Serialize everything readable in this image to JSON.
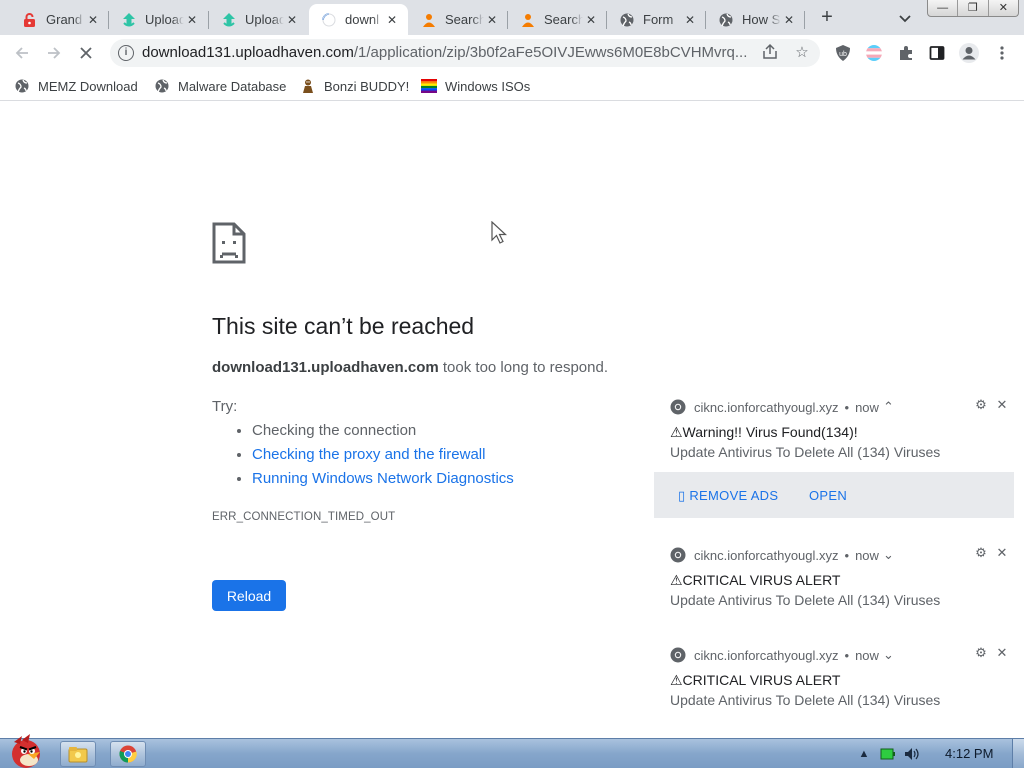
{
  "tabs": [
    {
      "title": "Grand",
      "icon": "red-lock-icon"
    },
    {
      "title": "Uploadhaven",
      "icon": "uploadhaven-icon"
    },
    {
      "title": "Uploadhaven",
      "icon": "uploadhaven-icon"
    },
    {
      "title": "downl",
      "icon": "loading-spinner-icon",
      "active": true
    },
    {
      "title": "Search",
      "icon": "search-person-icon"
    },
    {
      "title": "Search",
      "icon": "search-person-icon"
    },
    {
      "title": "Form",
      "icon": "globe-icon"
    },
    {
      "title": "How S",
      "icon": "globe-icon"
    }
  ],
  "window_controls": {
    "minimize": "—",
    "restore": "❐",
    "close": "✕"
  },
  "toolbar": {
    "url_host": "download131.uploadhaven.com",
    "url_path": "/1/application/zip/3b0f2aFe5OIVJEwws6M0E8bCVHMvrq..."
  },
  "bookmarks": [
    {
      "label": "MEMZ Download",
      "icon": "globe-icon"
    },
    {
      "label": "Malware Database",
      "icon": "globe-icon"
    },
    {
      "label": "Bonzi BUDDY!",
      "icon": "bonzi-icon"
    },
    {
      "label": "Windows ISOs",
      "icon": "windows-flag-icon"
    }
  ],
  "error": {
    "title": "This site can’t be reached",
    "host": "download131.uploadhaven.com",
    "desc_suffix": " took too long to respond.",
    "try_label": "Try:",
    "suggestions": [
      {
        "text": "Checking the connection",
        "link": false
      },
      {
        "text": "Checking the proxy and the firewall",
        "link": true
      },
      {
        "text": "Running Windows Network Diagnostics",
        "link": true
      }
    ],
    "code": "ERR_CONNECTION_TIMED_OUT",
    "reload_label": "Reload"
  },
  "notifications": [
    {
      "source": "ciknc.ionforcathyougl.xyz",
      "time": "now",
      "chevron": "⌃",
      "title": "⚠Warning!! Virus Found(134)!",
      "body": "Update Antivirus To Delete All (134) Viruses",
      "actions": [
        "▯ REMOVE ADS",
        "OPEN"
      ]
    },
    {
      "source": "ciknc.ionforcathyougl.xyz",
      "time": "now",
      "chevron": "⌄",
      "title": "⚠CRITICAL VIRUS ALERT",
      "body": "Update Antivirus To Delete All (134) Viruses"
    },
    {
      "source": "ciknc.ionforcathyougl.xyz",
      "time": "now",
      "chevron": "⌄",
      "title": "⚠CRITICAL VIRUS ALERT",
      "body": "Update Antivirus To Delete All (134) Viruses"
    }
  ],
  "taskbar": {
    "clock": "4:12 PM"
  },
  "colors": {
    "accent": "#1a73e8",
    "tabstrip": "#dee1e6",
    "omnibox": "#f1f3f4"
  }
}
